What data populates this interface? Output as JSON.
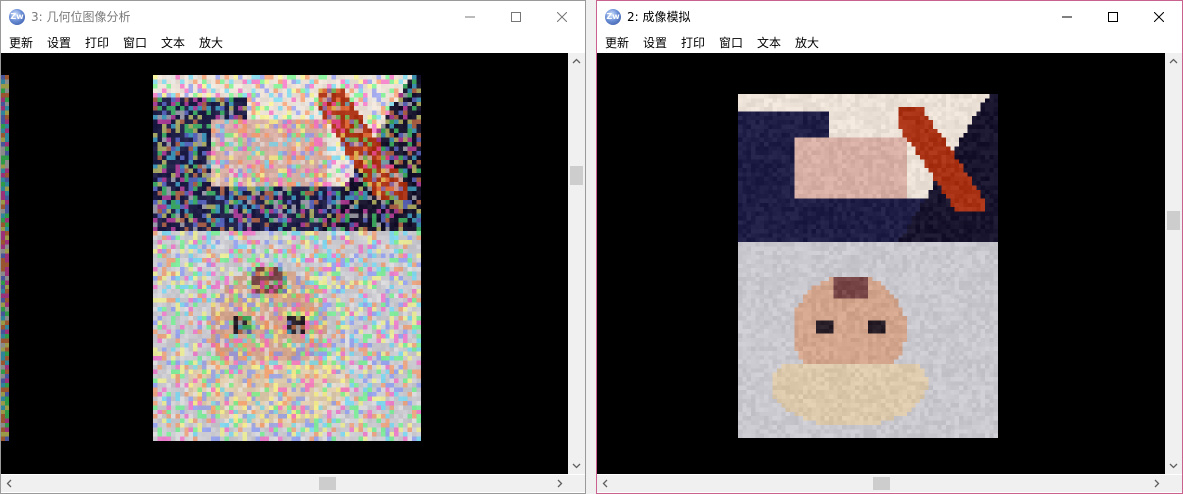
{
  "windows": {
    "left": {
      "title": "3: 几何位图像分析",
      "icon": "app-logo-icon",
      "icon_label": "Zw",
      "image_kind": "noisy"
    },
    "right": {
      "title": "2: 成像模拟",
      "icon": "app-logo-icon",
      "icon_label": "Zw",
      "image_kind": "inverted"
    }
  },
  "menu": [
    "更新",
    "设置",
    "打印",
    "窗口",
    "文本",
    "放大"
  ],
  "icons": {
    "minimize": "minimize-icon",
    "maximize": "maximize-icon",
    "close": "close-icon",
    "scroll_up": "chevron-up-icon",
    "scroll_down": "chevron-down-icon",
    "scroll_left": "chevron-left-icon",
    "scroll_right": "chevron-right-icon"
  },
  "colors": {
    "active_border": "#c9628f",
    "inactive_border": "#9a9a9a",
    "canvas_bg": "#000000"
  }
}
